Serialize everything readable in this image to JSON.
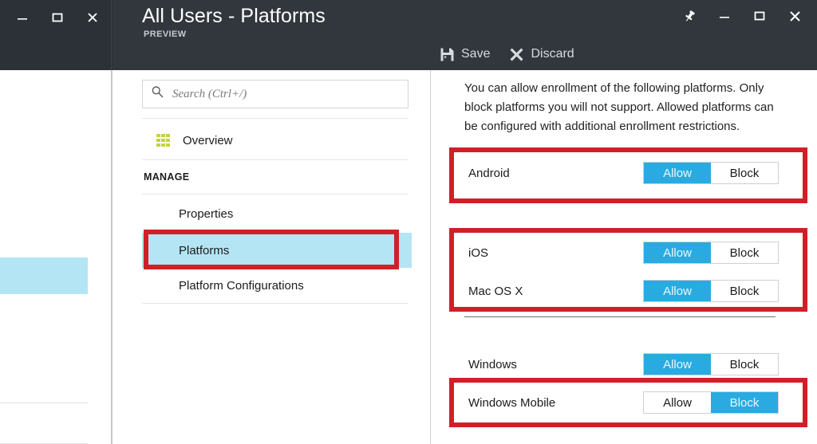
{
  "window": {
    "left_controls": [
      {
        "name": "minimize-button",
        "glyph": "minimize"
      },
      {
        "name": "restore-button",
        "glyph": "restore"
      },
      {
        "name": "close-button",
        "glyph": "close"
      }
    ],
    "right_controls": [
      {
        "name": "pin-button",
        "glyph": "pin"
      },
      {
        "name": "minimize-button",
        "glyph": "minimize"
      },
      {
        "name": "maximize-button",
        "glyph": "maximize"
      },
      {
        "name": "close-button",
        "glyph": "close"
      }
    ]
  },
  "header": {
    "title": "All Users - Platforms",
    "subtitle": "PREVIEW"
  },
  "toolbar": {
    "save_label": "Save",
    "save_icon": "save-icon",
    "discard_label": "Discard",
    "discard_icon": "close-x-icon"
  },
  "nav": {
    "search": {
      "placeholder": "Search (Ctrl+/)",
      "value": "",
      "icon": "search-icon"
    },
    "overview": {
      "label": "Overview",
      "icon": "grid-overview-icon"
    },
    "section_label": "MANAGE",
    "items": [
      {
        "label": "Properties",
        "selected": false
      },
      {
        "label": "Platforms",
        "selected": true
      },
      {
        "label": "Platform Configurations",
        "selected": false
      }
    ]
  },
  "content": {
    "description": "You can allow enrollment of the following platforms. Only block platforms you will not support. Allowed platforms can be configured with additional enrollment restrictions.",
    "toggle_options": {
      "allow": "Allow",
      "block": "Block"
    },
    "platforms": [
      {
        "name": "Android",
        "state": "Allow"
      },
      {
        "name": "iOS",
        "state": "Allow"
      },
      {
        "name": "Mac OS X",
        "state": "Allow"
      },
      {
        "name": "Windows",
        "state": "Allow"
      },
      {
        "name": "Windows Mobile",
        "state": "Block"
      }
    ]
  },
  "colors": {
    "header_bg": "#31373d",
    "accent_blue": "#29abe2",
    "selected_nav": "#b3e5f5",
    "annotation_red": "#d02027",
    "overview_icon": "#c3d342"
  }
}
